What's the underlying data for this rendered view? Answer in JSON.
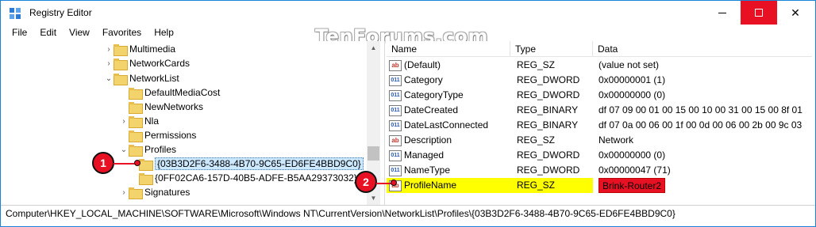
{
  "window": {
    "title": "Registry Editor",
    "minimize_label": "—",
    "close_label": "✕",
    "watermark": "TenForums.com"
  },
  "menu": {
    "items": [
      "File",
      "Edit",
      "View",
      "Favorites",
      "Help"
    ]
  },
  "tree": {
    "items": [
      {
        "label": "Multimedia",
        "arrow": "›"
      },
      {
        "label": "NetworkCards",
        "arrow": "›"
      },
      {
        "label": "NetworkList",
        "arrow": "⌄"
      },
      {
        "label": "DefaultMediaCost",
        "arrow": ""
      },
      {
        "label": "NewNetworks",
        "arrow": ""
      },
      {
        "label": "Nla",
        "arrow": "›"
      },
      {
        "label": "Permissions",
        "arrow": ""
      },
      {
        "label": "Profiles",
        "arrow": "⌄"
      },
      {
        "label": "{03B3D2F6-3488-4B70-9C65-ED6FE4BBD9C0}",
        "arrow": ""
      },
      {
        "label": "{0FF02CA6-157D-40B5-ADFE-B5AA29373032}",
        "arrow": ""
      },
      {
        "label": "Signatures",
        "arrow": "›"
      }
    ]
  },
  "list": {
    "columns": {
      "name": "Name",
      "type": "Type",
      "data": "Data"
    },
    "rows": [
      {
        "name": "(Default)",
        "type": "REG_SZ",
        "data": "(value not set)",
        "icon": "string-value-icon"
      },
      {
        "name": "Category",
        "type": "REG_DWORD",
        "data": "0x00000001 (1)",
        "icon": "binary-value-icon"
      },
      {
        "name": "CategoryType",
        "type": "REG_DWORD",
        "data": "0x00000000 (0)",
        "icon": "binary-value-icon"
      },
      {
        "name": "DateCreated",
        "type": "REG_BINARY",
        "data": "df 07 09 00 01 00 15 00 10 00 31 00 15 00 8f 01",
        "icon": "binary-value-icon"
      },
      {
        "name": "DateLastConnected",
        "type": "REG_BINARY",
        "data": "df 07 0a 00 06 00 1f 00 0d 00 06 00 2b 00 9c 03",
        "icon": "binary-value-icon"
      },
      {
        "name": "Description",
        "type": "REG_SZ",
        "data": "Network",
        "icon": "string-value-icon"
      },
      {
        "name": "Managed",
        "type": "REG_DWORD",
        "data": "0x00000000 (0)",
        "icon": "binary-value-icon"
      },
      {
        "name": "NameType",
        "type": "REG_DWORD",
        "data": "0x00000047 (71)",
        "icon": "binary-value-icon"
      },
      {
        "name": "ProfileName",
        "type": "REG_SZ",
        "data": "Brink-Router2",
        "icon": "string-value-icon"
      }
    ]
  },
  "status": {
    "path": "Computer\\HKEY_LOCAL_MACHINE\\SOFTWARE\\Microsoft\\Windows NT\\CurrentVersion\\NetworkList\\Profiles\\{03B3D2F6-3488-4B70-9C65-ED6FE4BBD9C0}"
  },
  "callouts": {
    "one": "1",
    "two": "2"
  },
  "colors": {
    "accent_red": "#e81123",
    "highlight_yellow": "#ffff00"
  }
}
